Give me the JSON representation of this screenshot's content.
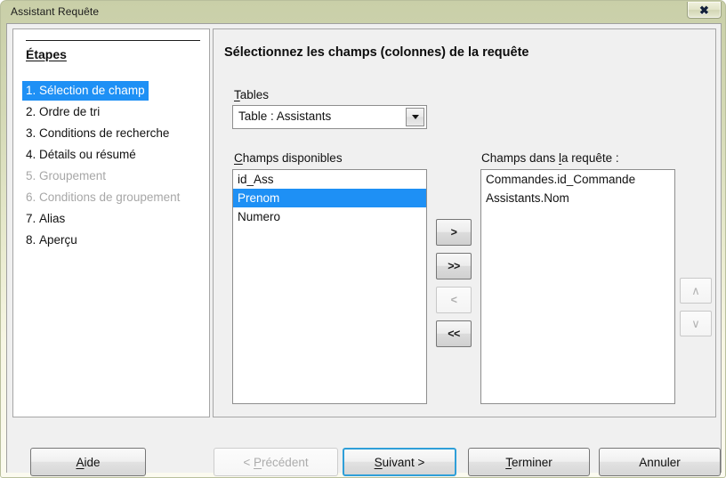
{
  "window": {
    "title": "Assistant Requête",
    "close_label": "✖",
    "close_icon": "close-icon"
  },
  "steps_pane": {
    "heading": "Étapes",
    "items": [
      {
        "num": "1.",
        "label": "Sélection de champ",
        "state": "active"
      },
      {
        "num": "2.",
        "label": "Ordre de tri",
        "state": "normal"
      },
      {
        "num": "3.",
        "label": "Conditions de recherche",
        "state": "normal"
      },
      {
        "num": "4.",
        "label": "Détails ou résumé",
        "state": "normal"
      },
      {
        "num": "5.",
        "label": "Groupement",
        "state": "disabled"
      },
      {
        "num": "6.",
        "label": "Conditions de groupement",
        "state": "disabled"
      },
      {
        "num": "7.",
        "label": "Alias",
        "state": "normal"
      },
      {
        "num": "8.",
        "label": "Aperçu",
        "state": "normal"
      }
    ]
  },
  "main": {
    "heading": "Sélectionnez les champs (colonnes) de la requête",
    "tables": {
      "label_accel": "T",
      "label_rest": "ables",
      "selected": "Table : Assistants",
      "dropdown_icon": "chevron-down-icon"
    },
    "available": {
      "label_accel": "C",
      "label_rest": "hamps disponibles",
      "items": [
        {
          "text": "id_Ass",
          "selected": false
        },
        {
          "text": "Prenom",
          "selected": true
        },
        {
          "text": "Numero",
          "selected": false
        }
      ]
    },
    "query": {
      "label_pre": "Champs dans ",
      "label_accel": "l",
      "label_rest": "a requête :",
      "items": [
        {
          "text": "Commandes.id_Commande",
          "selected": false
        },
        {
          "text": "Assistants.Nom",
          "selected": false
        }
      ]
    },
    "transfer_buttons": [
      {
        "label": ">",
        "name": "move-right-button",
        "state": "enabled"
      },
      {
        "label": ">>",
        "name": "move-all-right-button",
        "state": "enabled"
      },
      {
        "label": "<",
        "name": "move-left-button",
        "state": "disabled"
      },
      {
        "label": "<<",
        "name": "move-all-left-button",
        "state": "enabled"
      }
    ],
    "order_buttons": [
      {
        "label": "∧",
        "name": "move-up-button",
        "state": "disabled"
      },
      {
        "label": "∨",
        "name": "move-down-button",
        "state": "disabled"
      }
    ]
  },
  "buttons": {
    "help": {
      "accel": "A",
      "rest": "ide",
      "pre": "",
      "state": "enabled"
    },
    "previous": {
      "accel": "P",
      "rest": "récédent",
      "pre": "< ",
      "state": "disabled"
    },
    "next": {
      "accel": "S",
      "rest": "uivant >",
      "pre": "",
      "state": "default"
    },
    "finish": {
      "accel": "T",
      "rest": "erminer",
      "pre": "",
      "state": "enabled"
    },
    "cancel": {
      "accel": "",
      "rest": "Annuler",
      "pre": "",
      "state": "enabled"
    }
  },
  "colors": {
    "selection_blue": "#1e90f5",
    "default_button_border": "#2f9fd8",
    "window_chrome": "#e9ebcf",
    "pane_background": "#f0f0f0"
  }
}
